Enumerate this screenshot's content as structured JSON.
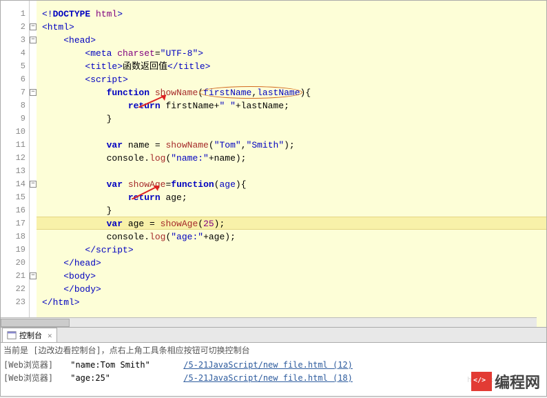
{
  "editor": {
    "lines": [
      {
        "n": 1,
        "fold": "",
        "html": "<span class='k-tag'>&lt;!</span><span class='k-kw'>DOCTYPE</span> <span class='k-attr'>html</span><span class='k-tag'>&gt;</span>"
      },
      {
        "n": 2,
        "fold": "-",
        "html": "<span class='k-tag'>&lt;html&gt;</span>"
      },
      {
        "n": 3,
        "fold": "-",
        "html": "    <span class='k-tag'>&lt;head&gt;</span>"
      },
      {
        "n": 4,
        "fold": "",
        "html": "        <span class='k-tag'>&lt;meta</span> <span class='k-attr'>charset</span>=<span class='k-str'>\"UTF-8\"</span><span class='k-tag'>&gt;</span>"
      },
      {
        "n": 5,
        "fold": "",
        "html": "        <span class='k-tag'>&lt;title&gt;</span><span class='k-txt'>函数返回值</span><span class='k-tag'>&lt;/title&gt;</span>"
      },
      {
        "n": 6,
        "fold": "",
        "html": "        <span class='k-tag'>&lt;script&gt;</span>"
      },
      {
        "n": 7,
        "fold": "-",
        "html": "            <span class='k-kw'>function</span> <span class='k-func'>showName</span>(<span class='k-param'>firstName</span>,<span class='k-param'>lastName</span>){"
      },
      {
        "n": 8,
        "fold": "",
        "html": "                <span class='k-kw'>return</span> firstName+<span class='k-str'>\" \"</span>+lastName;"
      },
      {
        "n": 9,
        "fold": "",
        "html": "            }"
      },
      {
        "n": 10,
        "fold": "",
        "html": ""
      },
      {
        "n": 11,
        "fold": "",
        "html": "            <span class='k-kw'>var</span> name = <span class='k-func'>showName</span>(<span class='k-str'>\"Tom\"</span>,<span class='k-str'>\"Smith\"</span>);"
      },
      {
        "n": 12,
        "fold": "",
        "html": "            console.<span class='k-func'>log</span>(<span class='k-str'>\"name:\"</span>+name);"
      },
      {
        "n": 13,
        "fold": "",
        "html": ""
      },
      {
        "n": 14,
        "fold": "-",
        "html": "            <span class='k-kw'>var</span> <span class='k-func'>showAge</span>=<span class='k-kw'>function</span>(<span class='k-param'>age</span>){"
      },
      {
        "n": 15,
        "fold": "",
        "html": "                <span class='k-kw'>return</span> age;"
      },
      {
        "n": 16,
        "fold": "",
        "html": "            }"
      },
      {
        "n": 17,
        "fold": "",
        "highlight": true,
        "html": "            <span class='k-kw'>var</span> age = <span class='k-func'>showAge</span>(<span class='k-num'>25</span>);"
      },
      {
        "n": 18,
        "fold": "",
        "html": "            console.<span class='k-func'>log</span>(<span class='k-str'>\"age:\"</span>+age);"
      },
      {
        "n": 19,
        "fold": "",
        "html": "        <span class='k-tag'>&lt;/script&gt;</span>"
      },
      {
        "n": 20,
        "fold": "",
        "html": "    <span class='k-tag'>&lt;/head&gt;</span>"
      },
      {
        "n": 21,
        "fold": "-",
        "html": "    <span class='k-tag'>&lt;body&gt;</span>"
      },
      {
        "n": 22,
        "fold": "",
        "html": "    <span class='k-tag'>&lt;/body&gt;</span>"
      },
      {
        "n": 23,
        "fold": "",
        "html": "<span class='k-tag'>&lt;/html&gt;</span>"
      }
    ]
  },
  "console": {
    "tab_label": "控制台",
    "hint": "当前是 [边改边看控制台]，点右上角工具条相应按钮可切换控制台",
    "rows": [
      {
        "src": "[Web浏览器]",
        "msg": "\"name:Tom Smith\"",
        "link": "/5-21JavaScript/new file.html (12)"
      },
      {
        "src": "[Web浏览器]",
        "msg": "\"age:25\"",
        "link": "/5-21JavaScript/new file.html (18)"
      }
    ]
  },
  "watermark": {
    "text": "编程网",
    "url": "https://blog.csd"
  }
}
